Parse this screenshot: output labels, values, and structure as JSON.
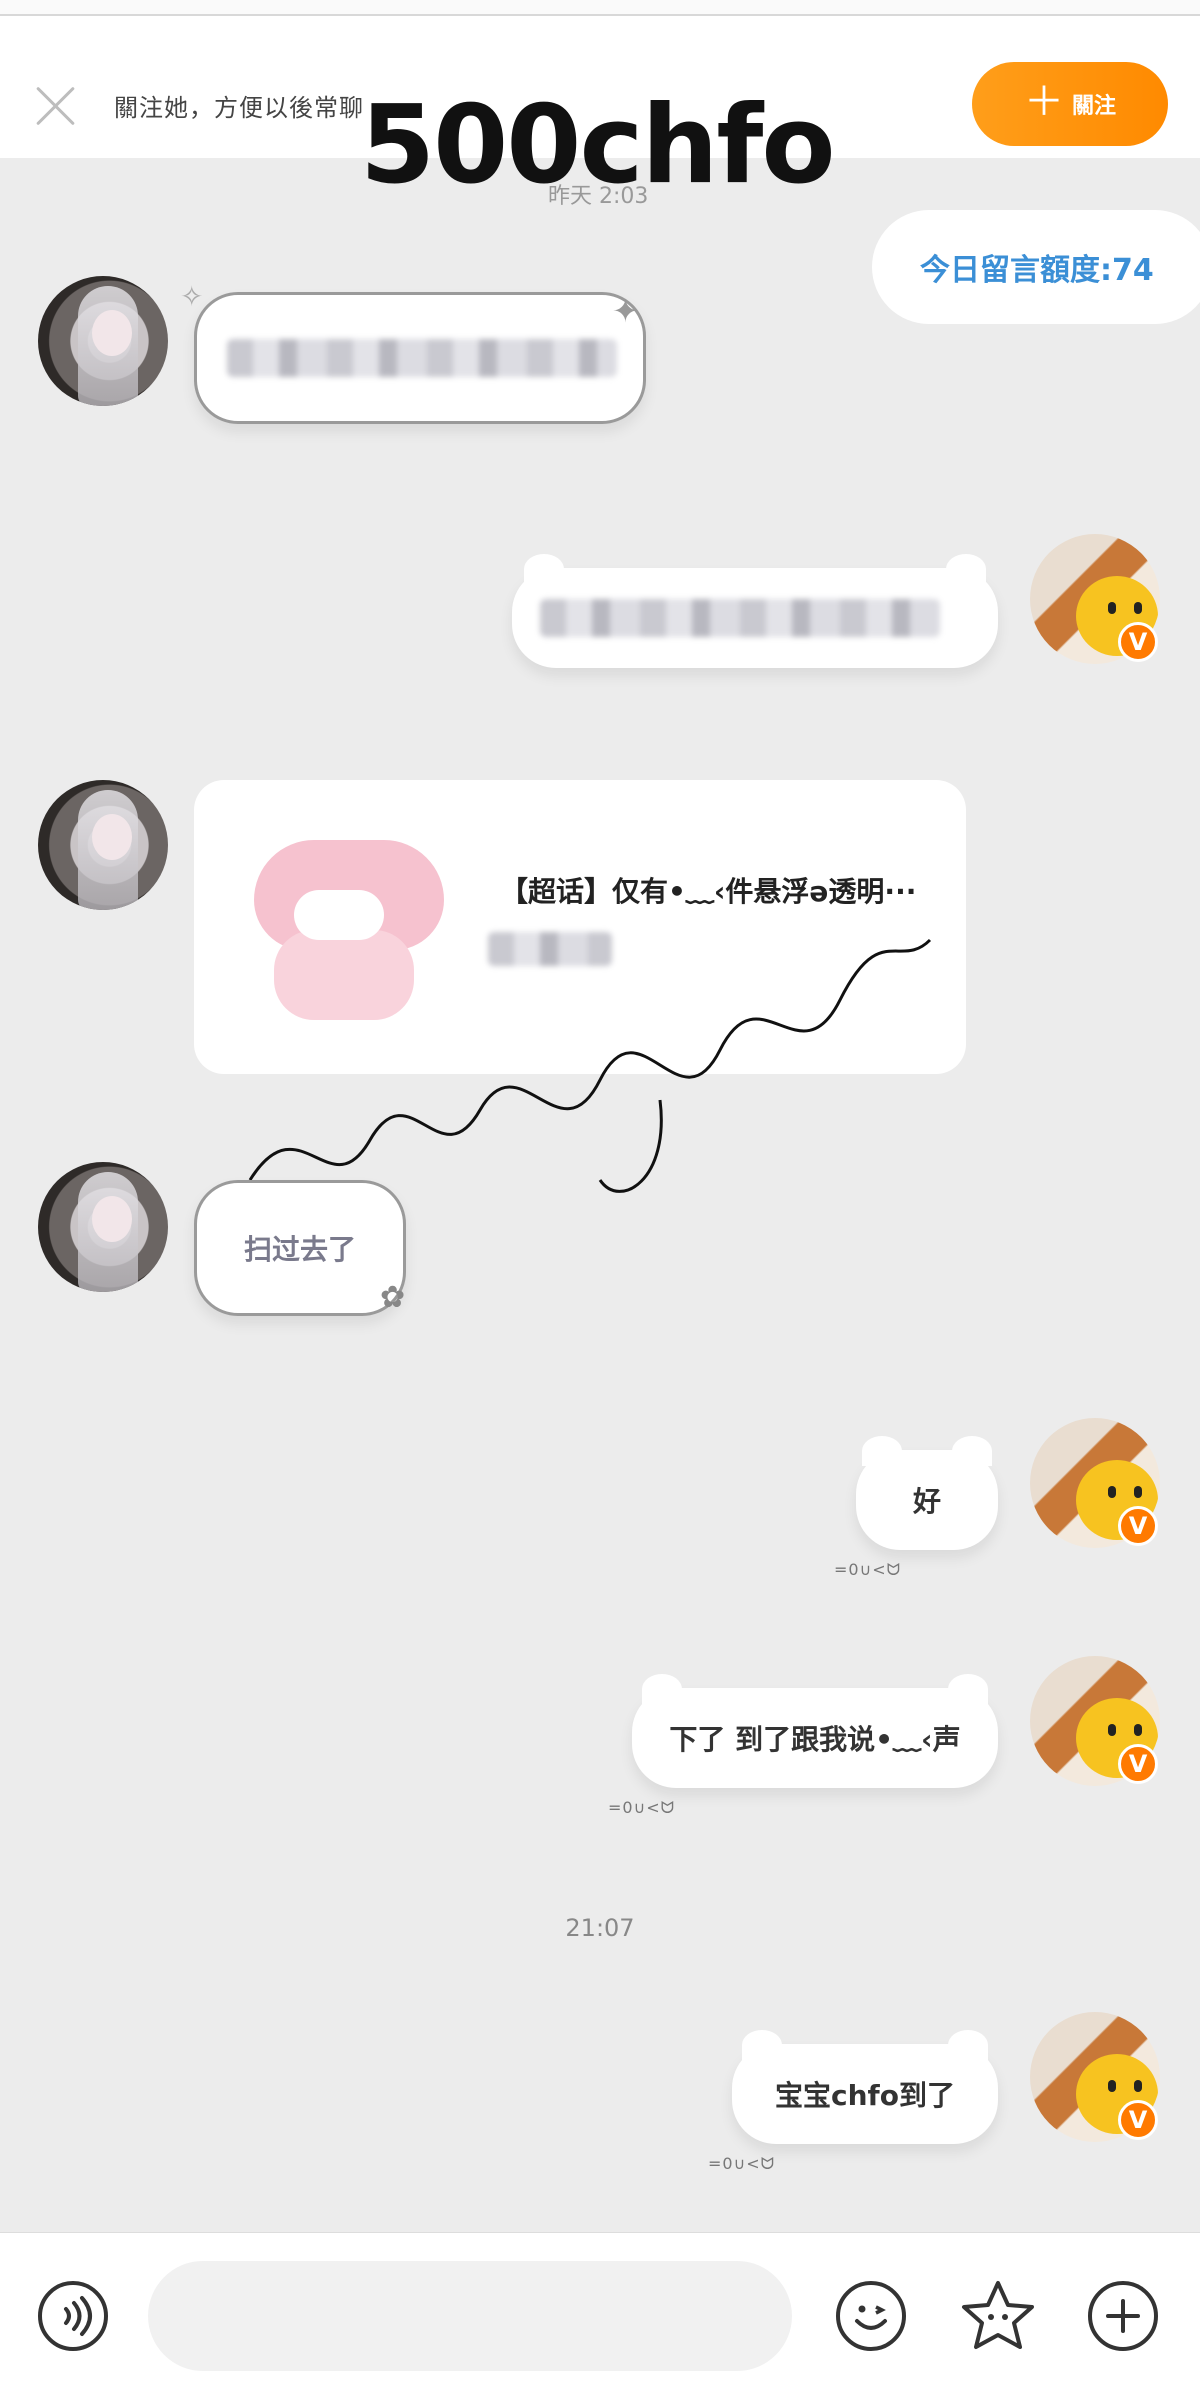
{
  "banner": {
    "close_icon": "close-icon",
    "text": "關注她，方便以後常聊",
    "follow_label": "關注",
    "follow_color": "#ff9100",
    "watermark": "500chfo"
  },
  "chat": {
    "timestamp_top": "昨天 2:03",
    "quota": "今日留言額度:74",
    "card": {
      "title": "【超话】仅有•﹏‹件悬浮ə透明···",
      "signature": "tianmangin"
    },
    "messages": [
      {
        "text": "扫过去了"
      },
      {
        "text": "好",
        "tag": "=0∪<ᗢ"
      },
      {
        "text": "下了 到了跟我说•﹏‹声",
        "tag": "=0∪<ᗢ"
      },
      {
        "text": "宝宝chfo到了",
        "tag": "=0∪<ᗢ"
      }
    ],
    "time_divider": "21:07",
    "badge": "V"
  },
  "composer": {
    "voice_icon": "voice-icon",
    "emoji_icon": "emoji-icon",
    "sticker_icon": "sticker-icon",
    "add_icon": "add-icon"
  }
}
